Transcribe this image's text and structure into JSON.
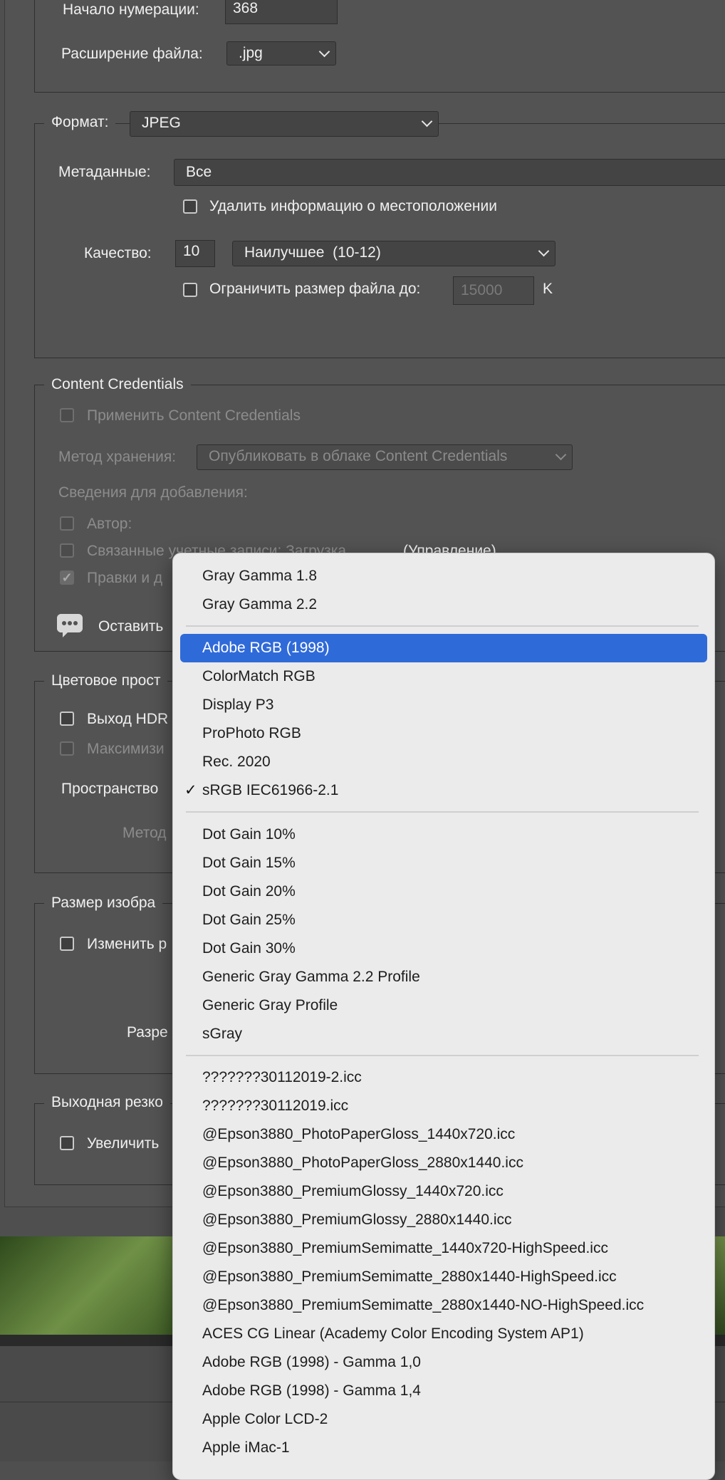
{
  "numbering": {
    "start_label": "Начало нумерации:",
    "start_value": "368",
    "ext_label": "Расширение файла:",
    "ext_value": ".jpg"
  },
  "format": {
    "legend": "Формат:",
    "value": "JPEG"
  },
  "metadata": {
    "label": "Метаданные:",
    "value": "Все",
    "remove_location": "Удалить информацию о местоположении"
  },
  "quality": {
    "label": "Качество:",
    "value": "10",
    "preset": "Наилучшее  (10-12)",
    "limit_label": "Ограничить размер файла до:",
    "limit_placeholder": "15000",
    "limit_unit": "K"
  },
  "content_credentials": {
    "legend": "Content Credentials",
    "apply": "Применить Content Credentials",
    "storage_label": "Метод хранения:",
    "storage_value": "Опубликовать в облаке Content Credentials",
    "info_label": "Сведения для добавления:",
    "author": "Автор:",
    "linked_accounts": "Связанные учетные записи: Загрузка",
    "manage": "(Управление)",
    "edits": "Правки и д",
    "leave": "Оставить"
  },
  "color_space": {
    "legend": "Цветовое прост",
    "hdr": "Выход HDR",
    "maximize": "Максимизи",
    "space_label": "Пространство",
    "method_label": "Метод"
  },
  "image_size": {
    "legend": "Размер изобра",
    "resize": "Изменить р",
    "resolution_label": "Разре"
  },
  "sharpening": {
    "legend": "Выходная резко",
    "enlarge": "Увеличить"
  },
  "menu": {
    "group1": [
      "Gray Gamma 1.8",
      "Gray Gamma 2.2"
    ],
    "group2": [
      "Adobe RGB (1998)",
      "ColorMatch RGB",
      "Display P3",
      "ProPhoto RGB",
      "Rec. 2020",
      "sRGB IEC61966-2.1"
    ],
    "group3": [
      "Dot Gain 10%",
      "Dot Gain 15%",
      "Dot Gain 20%",
      "Dot Gain 25%",
      "Dot Gain 30%",
      "Generic Gray Gamma 2.2 Profile",
      "Generic Gray Profile",
      "sGray"
    ],
    "group4": [
      "???????30112019-2.icc",
      "???????30112019.icc",
      "@Epson3880_PhotoPaperGloss_1440x720.icc",
      "@Epson3880_PhotoPaperGloss_2880x1440.icc",
      "@Epson3880_PremiumGlossy_1440x720.icc",
      "@Epson3880_PremiumGlossy_2880x1440.icc",
      "@Epson3880_PremiumSemimatte_1440x720-HighSpeed.icc",
      "@Epson3880_PremiumSemimatte_2880x1440-HighSpeed.icc",
      "@Epson3880_PremiumSemimatte_2880x1440-NO-HighSpeed.icc",
      "ACES CG Linear (Academy Color Encoding System AP1)",
      "Adobe RGB (1998) - Gamma 1,0",
      "Adobe RGB (1998) - Gamma 1,4",
      "Apple Color LCD-2",
      "Apple iMac-1"
    ],
    "highlighted": "Adobe RGB (1998)",
    "checked": "sRGB IEC61966-2.1",
    "checkmark": "✓"
  },
  "colors": {
    "highlight": "#2f6ad9",
    "menu_bg": "#ebebeb",
    "dialog_bg": "#535353"
  }
}
